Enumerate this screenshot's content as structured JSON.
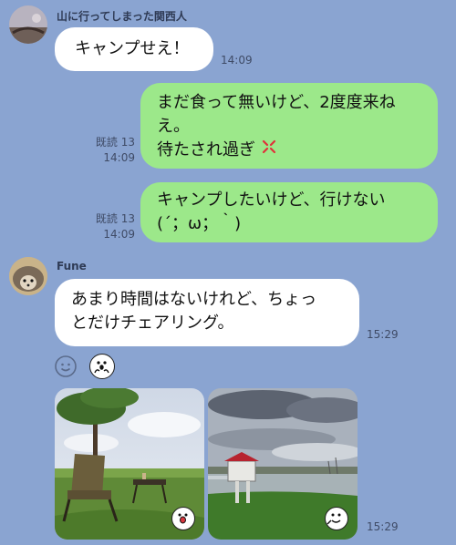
{
  "messages": [
    {
      "sender": "山に行ってしまった関西人",
      "text": "キャンプせえ！",
      "time": "14:09"
    },
    {
      "line1": "まだ食って無いけど、2度度来ね",
      "line2": "え。",
      "line3": "待たされ過ぎ",
      "emoji": "angry-icon",
      "read": "既読 13",
      "time": "14:09"
    },
    {
      "line1": "キャンプしたいけど、行けない",
      "line2": "(´；ω；｀)",
      "read": "既読 13",
      "time": "14:09"
    },
    {
      "sender": "Fune",
      "line1": "あまり時間はないけれど、ちょっ",
      "line2": "とだけチェアリング。",
      "time": "15:29"
    },
    {
      "type": "photos",
      "time": "15:29"
    }
  ],
  "colors": {
    "background": "#8aa4d1",
    "bubble_incoming": "#ffffff",
    "bubble_outgoing": "#9ce88a"
  }
}
